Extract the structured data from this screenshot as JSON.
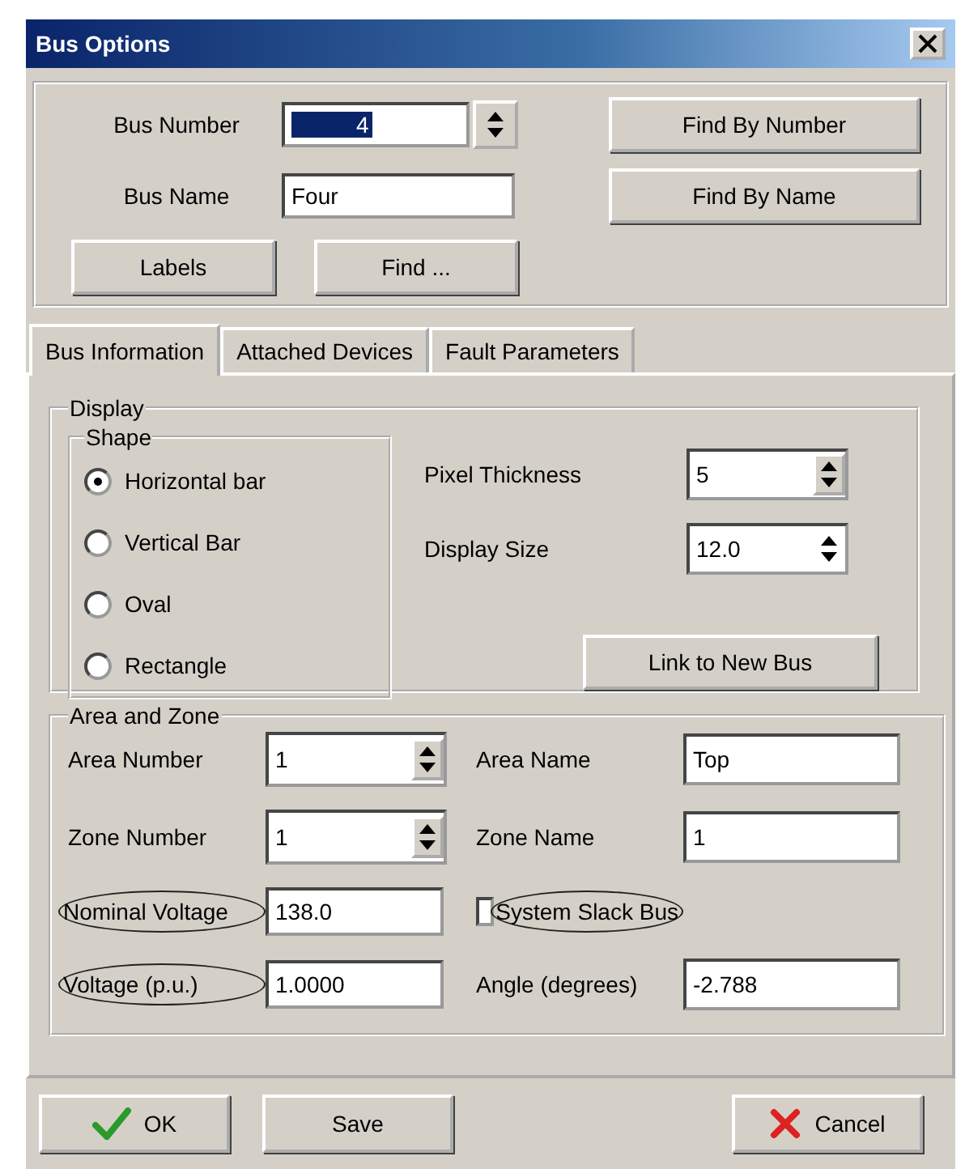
{
  "window": {
    "title": "Bus Options"
  },
  "bus": {
    "number_label": "Bus Number",
    "number_value": "4",
    "name_label": "Bus Name",
    "name_value": "Four"
  },
  "top_buttons": [
    "Find By Number",
    "Find By Name",
    "Labels",
    "Find ..."
  ],
  "tabs": [
    {
      "label": "Bus Information",
      "selected": true
    },
    {
      "label": "Attached Devices",
      "selected": false
    },
    {
      "label": "Fault Parameters",
      "selected": false
    }
  ],
  "display": {
    "title": "Display",
    "shape_title": "Shape",
    "shapes": [
      {
        "label": "Horizontal bar",
        "selected": true
      },
      {
        "label": "Vertical Bar",
        "selected": false
      },
      {
        "label": "Oval",
        "selected": false
      },
      {
        "label": "Rectangle",
        "selected": false
      }
    ],
    "pixel_thickness_label": "Pixel Thickness",
    "pixel_thickness": "5",
    "display_size_label": "Display Size",
    "display_size": "12.0",
    "link_button": "Link to New Bus"
  },
  "area_zone": {
    "title": "Area and Zone",
    "area_number_label": "Area Number",
    "area_number": "1",
    "area_name_label": "Area Name",
    "area_name": "Top",
    "zone_number_label": "Zone Number",
    "zone_number": "1",
    "zone_name_label": "Zone Name",
    "zone_name": "1",
    "nominal_voltage_label": "Nominal Voltage",
    "nominal_voltage_circled": true,
    "nominal_voltage": "138.0",
    "slack_label": "System Slack Bus",
    "slack_circled": true,
    "slack_checked": false,
    "voltage_label": "Voltage (p.u.)",
    "voltage_circled": true,
    "voltage": "1.0000",
    "angle_label": "Angle (degrees)",
    "angle_circled": false,
    "angle": "-2.788"
  },
  "footer_buttons": [
    {
      "label": "OK",
      "kind": "ok"
    },
    {
      "label": "Save",
      "kind": "plain"
    },
    {
      "label": "Cancel",
      "kind": "cancel"
    }
  ]
}
